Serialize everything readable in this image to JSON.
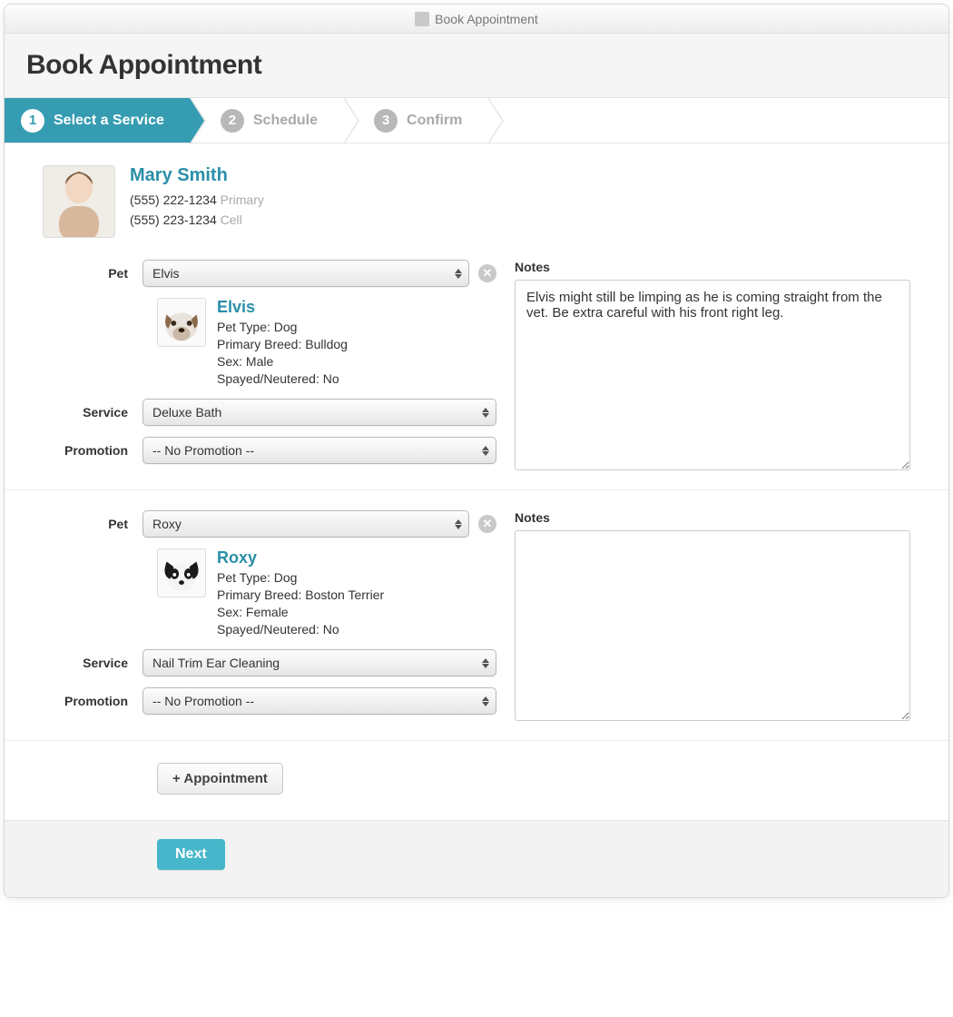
{
  "window": {
    "title": "Book Appointment"
  },
  "header": {
    "title": "Book Appointment"
  },
  "steps": [
    {
      "num": "1",
      "label": "Select a Service",
      "active": true
    },
    {
      "num": "2",
      "label": "Schedule",
      "active": false
    },
    {
      "num": "3",
      "label": "Confirm",
      "active": false
    }
  ],
  "customer": {
    "name": "Mary Smith",
    "phones": [
      {
        "number": "(555) 222-1234",
        "label": "Primary"
      },
      {
        "number": "(555) 223-1234",
        "label": "Cell"
      }
    ]
  },
  "labels": {
    "pet": "Pet",
    "service": "Service",
    "promotion": "Promotion",
    "notes": "Notes",
    "pet_type": "Pet Type: ",
    "primary_breed": "Primary Breed: ",
    "sex": "Sex: ",
    "spayed": "Spayed/Neutered: "
  },
  "appointments": [
    {
      "pet_select": "Elvis",
      "pet": {
        "name": "Elvis",
        "type": "Dog",
        "breed": "Bulldog",
        "sex": "Male",
        "spayed": "No"
      },
      "service": "Deluxe Bath",
      "promotion": "-- No Promotion --",
      "notes": "Elvis might still be limping as he is coming straight from the vet. Be extra careful with his front right leg."
    },
    {
      "pet_select": "Roxy",
      "pet": {
        "name": "Roxy",
        "type": "Dog",
        "breed": "Boston Terrier",
        "sex": "Female",
        "spayed": "No"
      },
      "service": "Nail Trim Ear Cleaning",
      "promotion": "-- No Promotion --",
      "notes": ""
    }
  ],
  "buttons": {
    "add_appointment": "+ Appointment",
    "next": "Next"
  }
}
